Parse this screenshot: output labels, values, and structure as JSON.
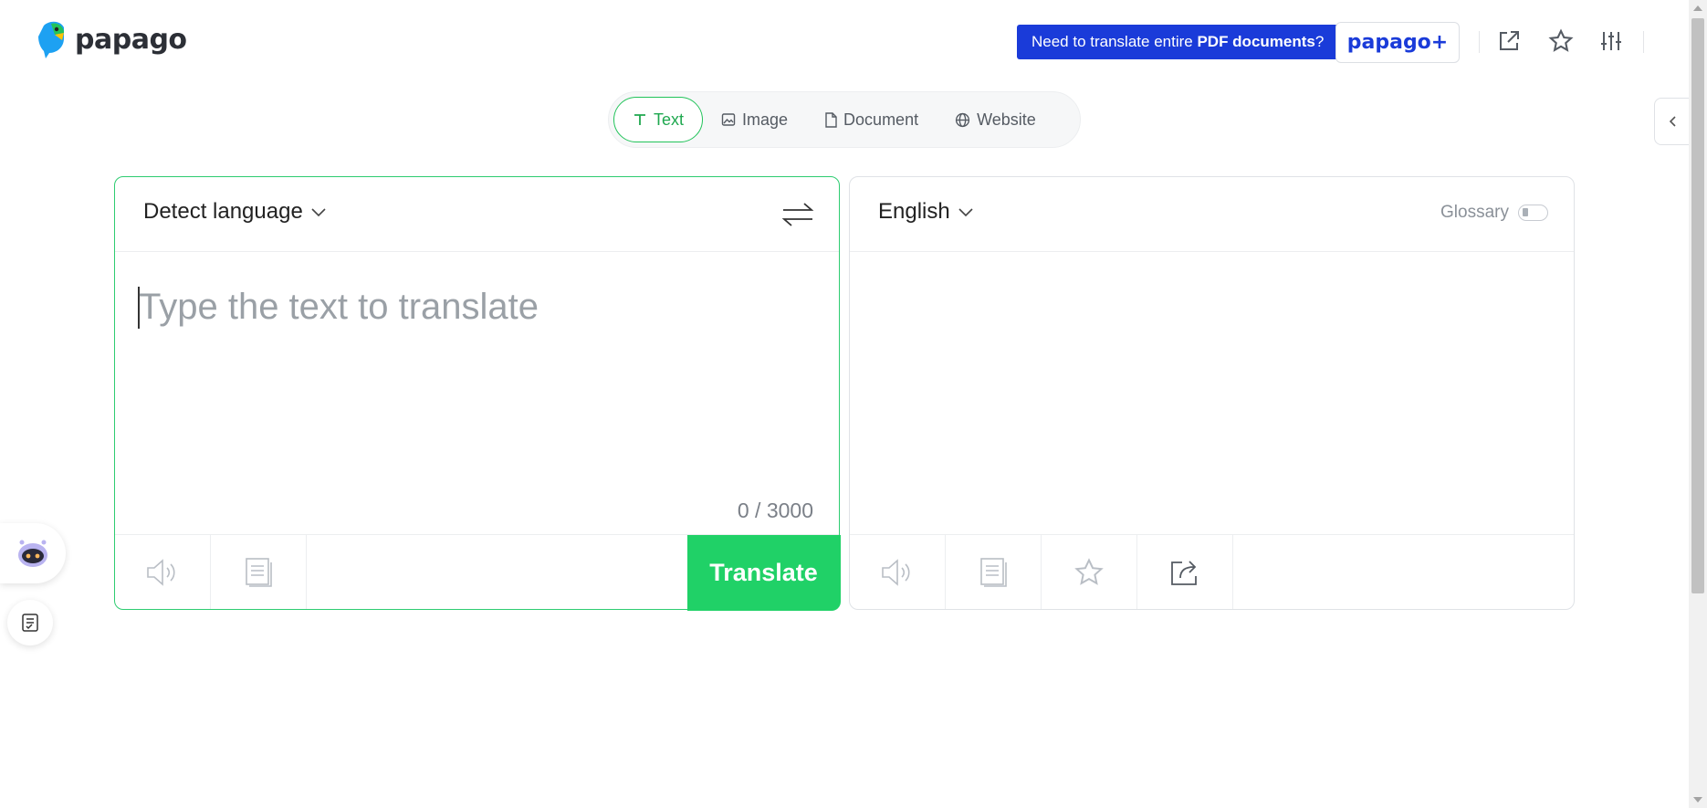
{
  "header": {
    "logo_text": "papago",
    "promo": {
      "text_before": "Need to translate entire ",
      "text_bold": "PDF documents",
      "text_after": "?"
    },
    "plus_label": "papago+",
    "icons": [
      "open-new-window-icon",
      "star-icon",
      "settings-sliders-icon"
    ]
  },
  "modes": [
    {
      "label": "Text",
      "icon": "text-icon",
      "active": true
    },
    {
      "label": "Image",
      "icon": "image-icon",
      "active": false
    },
    {
      "label": "Document",
      "icon": "document-icon",
      "active": false
    },
    {
      "label": "Website",
      "icon": "globe-icon",
      "active": false
    }
  ],
  "source": {
    "language": "Detect language",
    "placeholder": "Type the text to translate",
    "value": "",
    "counter": "0 / 3000",
    "translate_label": "Translate"
  },
  "target": {
    "language": "English",
    "glossary_label": "Glossary",
    "glossary_on": false
  },
  "colors": {
    "accent_green": "#20d167",
    "brand_blue": "#1a3bd9"
  }
}
